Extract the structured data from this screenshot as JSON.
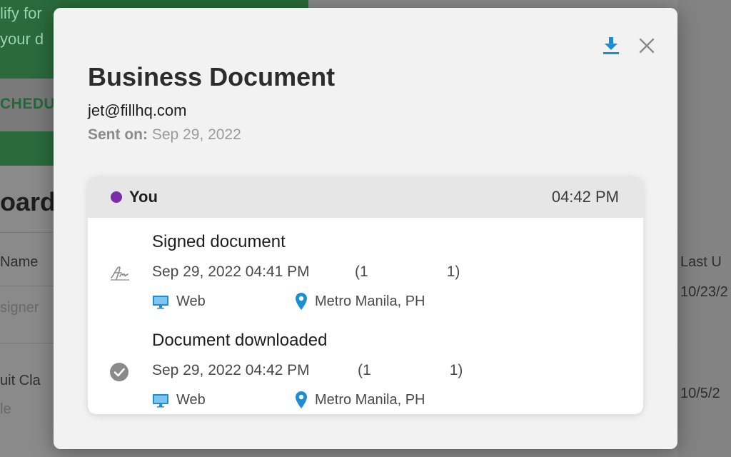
{
  "background": {
    "banner_line1": "lify for",
    "banner_line2": "your d",
    "schedule_label": "CHEDU",
    "board_title": "oard",
    "col_name": "Name",
    "col_last_updated": "Last U",
    "row1_name": "signer",
    "row1_date": "10/23/2",
    "row2_name": "uit Cla",
    "row2_sub": "le",
    "row2_date": "10/5/2"
  },
  "modal": {
    "title": "Business Document",
    "email": "jet@fillhq.com",
    "sent_label": "Sent on:",
    "sent_date": "Sep 29, 2022",
    "download_icon": "download-icon",
    "close_icon": "close-icon",
    "accent_color": "#1a8fd6"
  },
  "activity": {
    "actor": "You",
    "actor_color": "#7a2ba7",
    "time": "04:42 PM",
    "events": [
      {
        "title": "Signed document",
        "datetime": "Sep 29, 2022 04:41 PM",
        "ip_start": "(1",
        "ip_end": "1)",
        "platform": "Web",
        "location": "Metro Manila, PH",
        "icon": "signature-icon"
      },
      {
        "title": "Document downloaded",
        "datetime": "Sep 29, 2022 04:42 PM",
        "ip_start": "(1",
        "ip_end": "1)",
        "platform": "Web",
        "location": "Metro Manila, PH",
        "icon": "check-circle-icon"
      }
    ]
  }
}
